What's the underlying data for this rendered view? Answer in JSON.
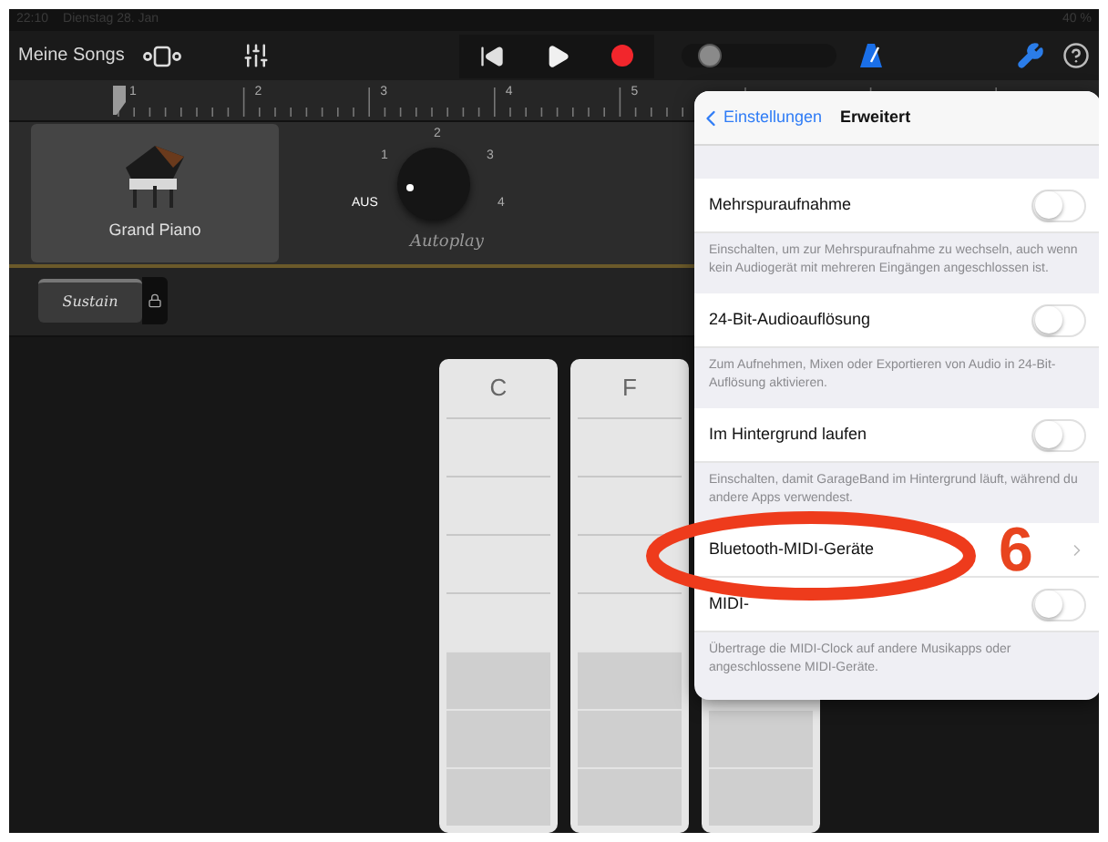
{
  "status_bar": {
    "time": "22:10",
    "date": "Dienstag 28. Jan",
    "battery": "40 %"
  },
  "toolbar": {
    "songs_button": "Meine Songs",
    "record_armed": true,
    "metronome_on": true,
    "volume": {
      "level": 0.12
    }
  },
  "ruler": {
    "marks": [
      "1",
      "2",
      "3",
      "4",
      "5"
    ]
  },
  "instrument": {
    "name": "Grand Piano"
  },
  "autoplay": {
    "title": "Autoplay",
    "positions": [
      {
        "label": "AUS",
        "selected": true
      },
      {
        "label": "1",
        "selected": false
      },
      {
        "label": "2",
        "selected": false
      },
      {
        "label": "3",
        "selected": false
      },
      {
        "label": "4",
        "selected": false
      }
    ]
  },
  "sustain": {
    "label": "Sustain"
  },
  "chord_strips": [
    {
      "label": "C"
    },
    {
      "label": "F"
    }
  ],
  "popover": {
    "back": "Einstellungen",
    "title": "Erweitert",
    "rows": [
      {
        "kind": "toggle",
        "label": "Mehrspuraufnahme",
        "on": false,
        "description": "Einschalten, um zur Mehrspuraufnahme zu wechseln, auch wenn kein Audiogerät mit mehreren Eingängen angeschlossen ist."
      },
      {
        "kind": "toggle",
        "label": "24-Bit-Audioauflösung",
        "on": false,
        "description": "Zum Aufnehmen, Mixen oder Exportieren von Audio in 24-Bit-Auflösung aktivieren."
      },
      {
        "kind": "toggle",
        "label": "Im Hintergrund laufen",
        "on": false,
        "description": "Einschalten, damit GarageBand im Hintergrund läuft, während du andere Apps verwendest."
      },
      {
        "kind": "link",
        "label": "Bluetooth-MIDI-Geräte"
      },
      {
        "kind": "toggle",
        "label": "MIDI-",
        "on": false,
        "description": "Übertrage die MIDI-Clock auf andere Musikapps oder angeschlossene MIDI-Geräte."
      }
    ]
  },
  "annotation": {
    "number": "6"
  }
}
